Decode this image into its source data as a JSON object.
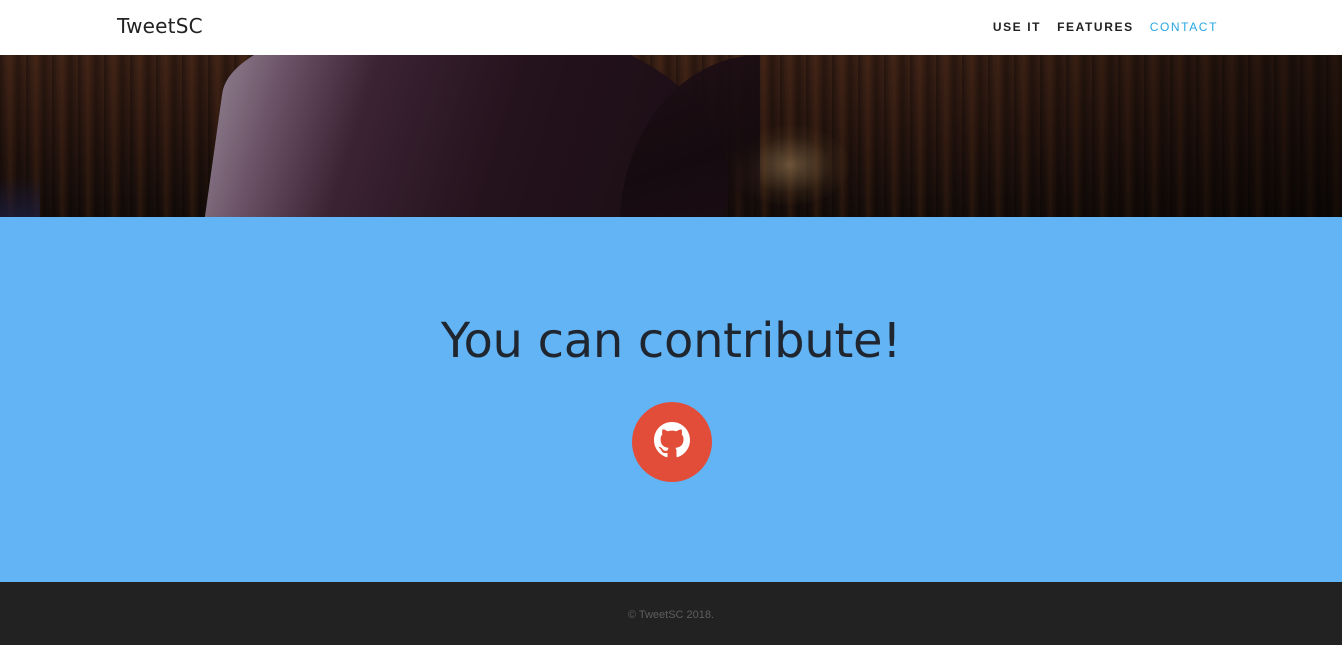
{
  "navbar": {
    "brand": "TweetSC",
    "links": [
      {
        "label": "USE IT",
        "active": false
      },
      {
        "label": "FEATURES",
        "active": false
      },
      {
        "label": "CONTACT",
        "active": true
      }
    ]
  },
  "hero": {
    "image": "wood-table-cloth-photo"
  },
  "contribute": {
    "heading": "You can contribute!",
    "button_icon": "github-icon",
    "background_color": "#62b4f5",
    "button_color": "#e24d3a"
  },
  "footer": {
    "copyright": "© TweetSC 2018."
  },
  "colors": {
    "accent": "#27a7e1",
    "footer_bg": "#222222"
  }
}
